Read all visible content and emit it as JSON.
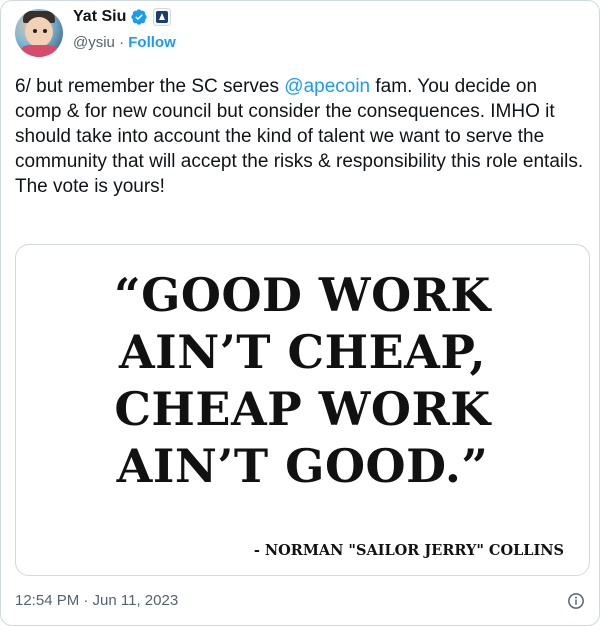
{
  "author": {
    "name": "Yat Siu",
    "handle": "@ysiu",
    "separator": "·",
    "follow_label": "Follow"
  },
  "tweet": {
    "text_before": "6/ but remember the SC serves ",
    "mention": "@apecoin",
    "text_after": " fam. You decide on comp & for new council but consider the consequences. IMHO it should take into account the kind of talent we want to serve the community that will accept the risks & responsibility this role entails. The vote is yours!",
    "timestamp": "12:54 PM · Jun 11, 2023"
  },
  "image": {
    "quote_line1": "“GOOD WORK",
    "quote_line2": "AIN’T CHEAP,",
    "quote_line3": "CHEAP WORK",
    "quote_line4": "AIN’T GOOD.”",
    "attribution": "- NORMAN \"SAILOR JERRY\" COLLINS"
  },
  "icons": {
    "verified": "verified-badge-icon",
    "affiliate": "affiliate-badge-icon",
    "info": "info-icon"
  },
  "colors": {
    "accent": "#1d9bf0",
    "secondary_text": "#536471",
    "border": "#cfd9de"
  }
}
